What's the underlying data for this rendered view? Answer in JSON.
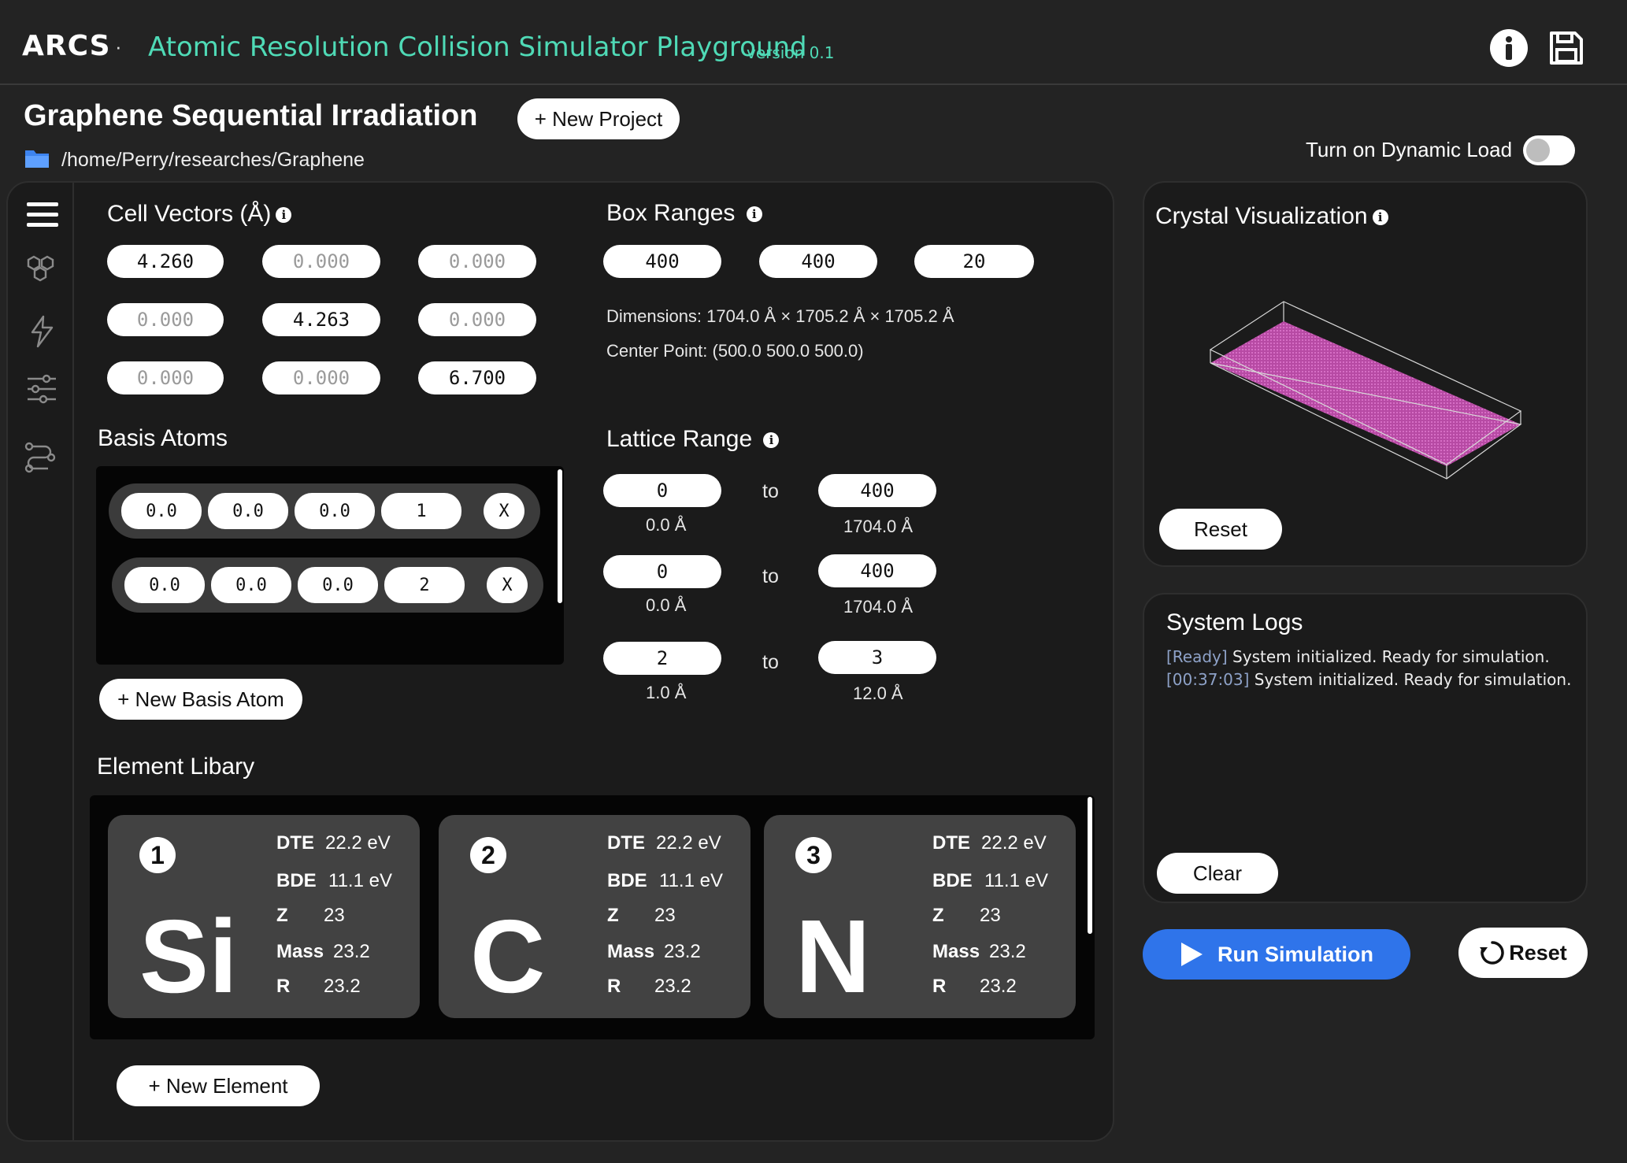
{
  "app": {
    "logo": "ARCS",
    "separator": "·",
    "title": "Atomic Resolution Collision Simulator Playground",
    "version": "version 0.1"
  },
  "header": {
    "info_icon": "info-icon",
    "save_icon": "save-disk-icon"
  },
  "project": {
    "title": "Graphene Sequential Irradiation",
    "new_project_label": "+ New Project",
    "path": "/home/Perry/researches/Graphene",
    "folder_icon": "folder-icon"
  },
  "dynamic_load": {
    "label": "Turn on Dynamic Load",
    "enabled": false
  },
  "sidebar": {
    "icons": [
      "menu-icon",
      "hexagons-icon",
      "bolt-icon",
      "sliders-icon",
      "workflow-icon"
    ]
  },
  "cell_vectors": {
    "title": "Cell Vectors (Å)",
    "values": [
      [
        "4.260",
        "0.000",
        "0.000"
      ],
      [
        "0.000",
        "4.263",
        "0.000"
      ],
      [
        "0.000",
        "0.000",
        "6.700"
      ]
    ]
  },
  "box_ranges": {
    "title": "Box Ranges",
    "values": [
      "400",
      "400",
      "20"
    ],
    "dimensions": "Dimensions: 1704.0 Å × 1705.2 Å × 1705.2 Å",
    "center": "Center Point: (500.0 500.0 500.0)"
  },
  "basis_atoms": {
    "title": "Basis Atoms",
    "rows": [
      {
        "x": "0.0",
        "y": "0.0",
        "z": "0.0",
        "type": "1",
        "remove": "X"
      },
      {
        "x": "0.0",
        "y": "0.0",
        "z": "0.0",
        "type": "2",
        "remove": "X"
      }
    ],
    "new_label": "+ New Basis Atom"
  },
  "lattice_range": {
    "title": "Lattice Range",
    "to_label": "to",
    "rows": [
      {
        "from": "0",
        "from_a": "0.0 Å",
        "to": "400",
        "to_a": "1704.0 Å"
      },
      {
        "from": "0",
        "from_a": "0.0 Å",
        "to": "400",
        "to_a": "1704.0 Å"
      },
      {
        "from": "2",
        "from_a": "1.0 Å",
        "to": "3",
        "to_a": "12.0 Å"
      }
    ]
  },
  "element_library": {
    "title": "Element Libary",
    "elements": [
      {
        "number": "1",
        "symbol": "Si",
        "dte_label": "DTE",
        "dte": "22.2 eV",
        "bde_label": "BDE",
        "bde": "11.1 eV",
        "z_label": "Z",
        "z": "23",
        "mass_label": "Mass",
        "mass": "23.2",
        "r_label": "R",
        "r": "23.2"
      },
      {
        "number": "2",
        "symbol": "C",
        "dte_label": "DTE",
        "dte": "22.2 eV",
        "bde_label": "BDE",
        "bde": "11.1 eV",
        "z_label": "Z",
        "z": "23",
        "mass_label": "Mass",
        "mass": "23.2",
        "r_label": "R",
        "r": "23.2"
      },
      {
        "number": "3",
        "symbol": "N",
        "dte_label": "DTE",
        "dte": "22.2 eV",
        "bde_label": "BDE",
        "bde": "11.1 eV",
        "z_label": "Z",
        "z": "23",
        "mass_label": "Mass",
        "mass": "23.2",
        "r_label": "R",
        "r": "23.2"
      }
    ],
    "new_label": "+ New Element"
  },
  "crystal": {
    "title": "Crystal Visualization",
    "reset_label": "Reset",
    "crystal_color": "#c251ad"
  },
  "logs": {
    "title": "System Logs",
    "entries": [
      {
        "tag": "[Ready]",
        "text": " System initialized. Ready for simulation."
      },
      {
        "tag": "[00:37:03]",
        "text": " System initialized. Ready for simulation."
      }
    ],
    "clear_label": "Clear"
  },
  "actions": {
    "run_label": "Run Simulation",
    "reset_label": "Reset",
    "run_color": "#2f74ea"
  }
}
